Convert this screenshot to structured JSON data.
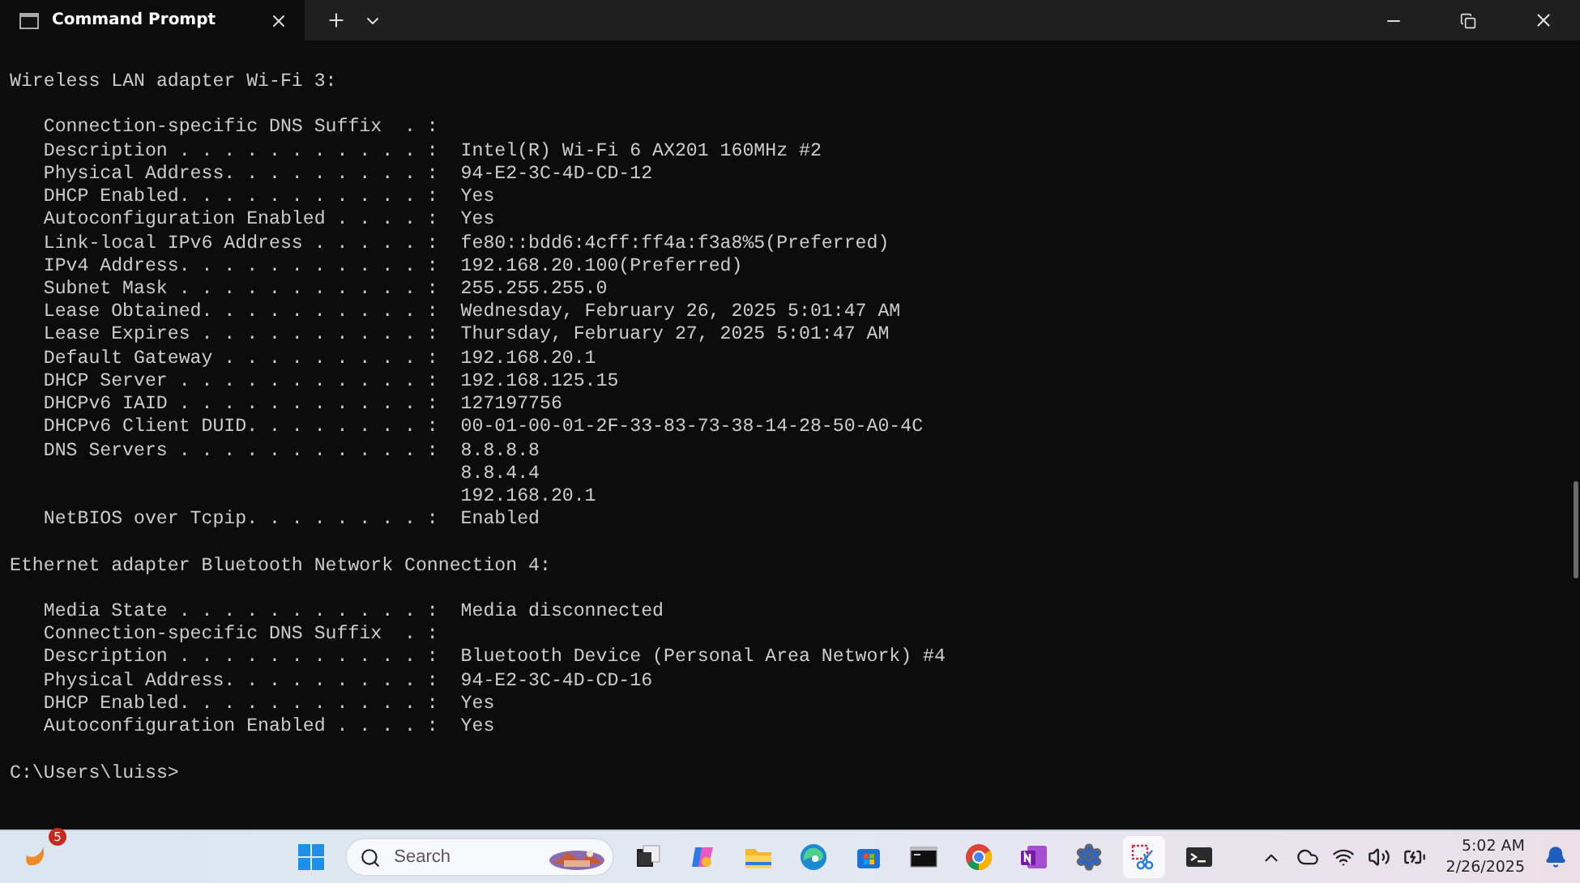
{
  "window": {
    "tab": {
      "title": "Command Prompt",
      "selected": true
    }
  },
  "terminal": {
    "sections": [
      {
        "heading": "Wireless LAN adapter Wi-Fi 3:",
        "fields": [
          {
            "label": "Connection-specific DNS Suffix  . :"
          },
          {
            "label": "Description . . . . . . . . . . . :",
            "values": [
              "Intel(R) Wi-Fi 6 AX201 160MHz #2"
            ]
          },
          {
            "label": "Physical Address. . . . . . . . . :",
            "values": [
              "94-E2-3C-4D-CD-12"
            ]
          },
          {
            "label": "DHCP Enabled. . . . . . . . . . . :",
            "values": [
              "Yes"
            ]
          },
          {
            "label": "Autoconfiguration Enabled . . . . :",
            "values": [
              "Yes"
            ]
          },
          {
            "label": "Link-local IPv6 Address . . . . . :",
            "values": [
              "fe80::bdd6:4cff:ff4a:f3a8%5(Preferred)"
            ]
          },
          {
            "label": "IPv4 Address. . . . . . . . . . . :",
            "values": [
              "192.168.20.100(Preferred)"
            ]
          },
          {
            "label": "Subnet Mask . . . . . . . . . . . :",
            "values": [
              "255.255.255.0"
            ]
          },
          {
            "label": "Lease Obtained. . . . . . . . . . :",
            "values": [
              "Wednesday, February 26, 2025 5:01:47 AM"
            ]
          },
          {
            "label": "Lease Expires . . . . . . . . . . :",
            "values": [
              "Thursday, February 27, 2025 5:01:47 AM"
            ]
          },
          {
            "label": "Default Gateway . . . . . . . . . :",
            "values": [
              "192.168.20.1"
            ]
          },
          {
            "label": "DHCP Server . . . . . . . . . . . :",
            "values": [
              "192.168.125.15"
            ]
          },
          {
            "label": "DHCPv6 IAID . . . . . . . . . . . :",
            "values": [
              "127197756"
            ]
          },
          {
            "label": "DHCPv6 Client DUID. . . . . . . . :",
            "values": [
              "00-01-00-01-2F-33-83-73-38-14-28-50-A0-4C"
            ]
          },
          {
            "label": "DNS Servers . . . . . . . . . . . :",
            "values": [
              "8.8.8.8",
              "8.8.4.4",
              "192.168.20.1"
            ]
          },
          {
            "label": "NetBIOS over Tcpip. . . . . . . . :",
            "values": [
              "Enabled"
            ]
          }
        ]
      },
      {
        "heading": "Ethernet adapter Bluetooth Network Connection 4:",
        "fields": [
          {
            "label": "Media State . . . . . . . . . . . :",
            "values": [
              "Media disconnected"
            ]
          },
          {
            "label": "Connection-specific DNS Suffix  . :"
          },
          {
            "label": "Description . . . . . . . . . . . :",
            "values": [
              "Bluetooth Device (Personal Area Network) #4"
            ]
          },
          {
            "label": "Physical Address. . . . . . . . . :",
            "values": [
              "94-E2-3C-4D-CD-16"
            ]
          },
          {
            "label": "DHCP Enabled. . . . . . . . . . . :",
            "values": [
              "Yes"
            ]
          },
          {
            "label": "Autoconfiguration Enabled . . . . :",
            "values": [
              "Yes"
            ]
          }
        ]
      }
    ],
    "prompt": "C:\\Users\\luiss>"
  },
  "taskbar": {
    "widget_badge": "5",
    "search": {
      "placeholder": "Search"
    },
    "apps": [
      {
        "kind": "taskview",
        "selected": false
      },
      {
        "kind": "copilot",
        "selected": false
      },
      {
        "kind": "folder",
        "selected": false
      },
      {
        "kind": "edge",
        "selected": false
      },
      {
        "kind": "store",
        "selected": false
      },
      {
        "kind": "console",
        "selected": false
      },
      {
        "kind": "chrome",
        "selected": false
      },
      {
        "kind": "onenote",
        "selected": false
      },
      {
        "kind": "settings",
        "selected": false
      },
      {
        "kind": "snip",
        "selected": true
      },
      {
        "kind": "terminal",
        "selected": false
      }
    ],
    "time": "5:02 AM",
    "date": "2/26/2025"
  }
}
